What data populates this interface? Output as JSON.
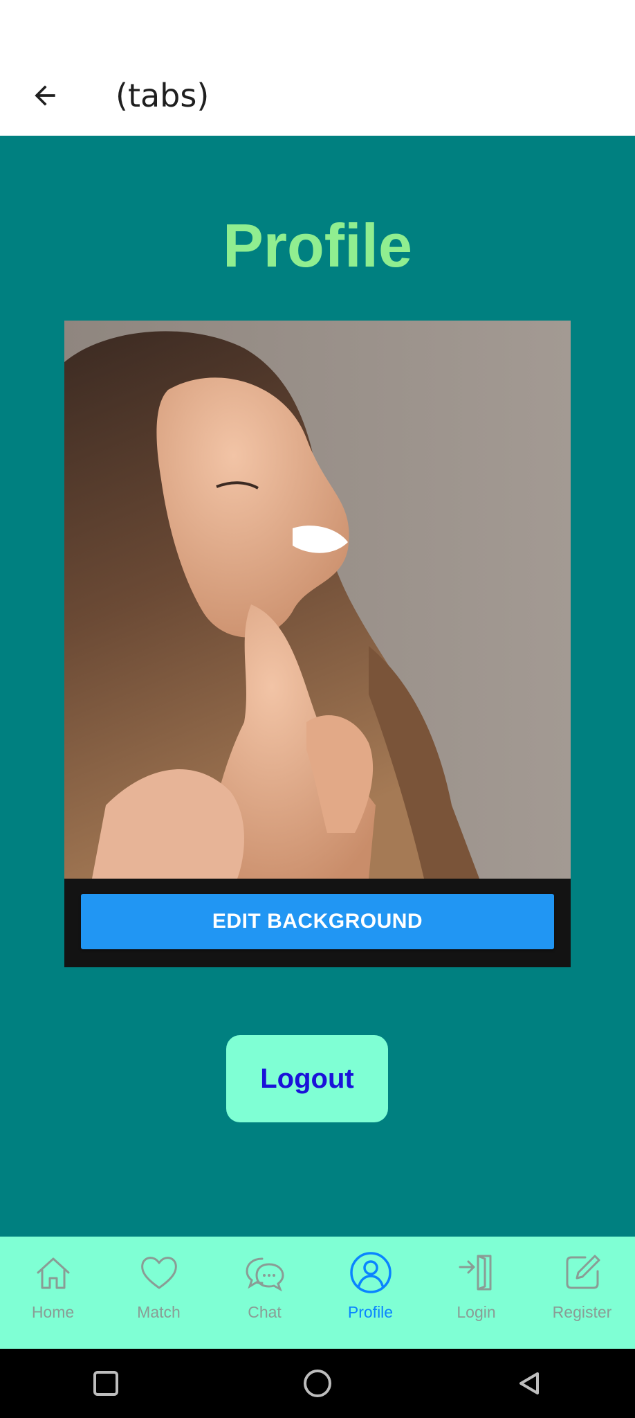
{
  "header": {
    "title": "(tabs)",
    "back_icon": "arrow-left-icon"
  },
  "profile": {
    "title": "Profile",
    "photo_alt": "Profile background photo",
    "edit_background_label": "EDIT BACKGROUND",
    "logout_label": "Logout"
  },
  "tabs": [
    {
      "label": "Home",
      "icon": "home-icon",
      "active": false
    },
    {
      "label": "Match",
      "icon": "heart-icon",
      "active": false
    },
    {
      "label": "Chat",
      "icon": "chat-bubbles-icon",
      "active": false
    },
    {
      "label": "Profile",
      "icon": "user-circle-icon",
      "active": true
    },
    {
      "label": "Login",
      "icon": "login-icon",
      "active": false
    },
    {
      "label": "Register",
      "icon": "edit-icon",
      "active": false
    }
  ],
  "colors": {
    "content_bg": "#008080",
    "title": "#90ee90",
    "edit_button": "#2196f3",
    "logout_button": "#7fffd4",
    "logout_text": "#1a12d9",
    "tab_bar": "#7fffd4",
    "tab_active": "#0a84ff",
    "tab_inactive": "#8a9c95"
  },
  "system_nav": [
    "square-icon",
    "circle-icon",
    "triangle-back-icon"
  ]
}
